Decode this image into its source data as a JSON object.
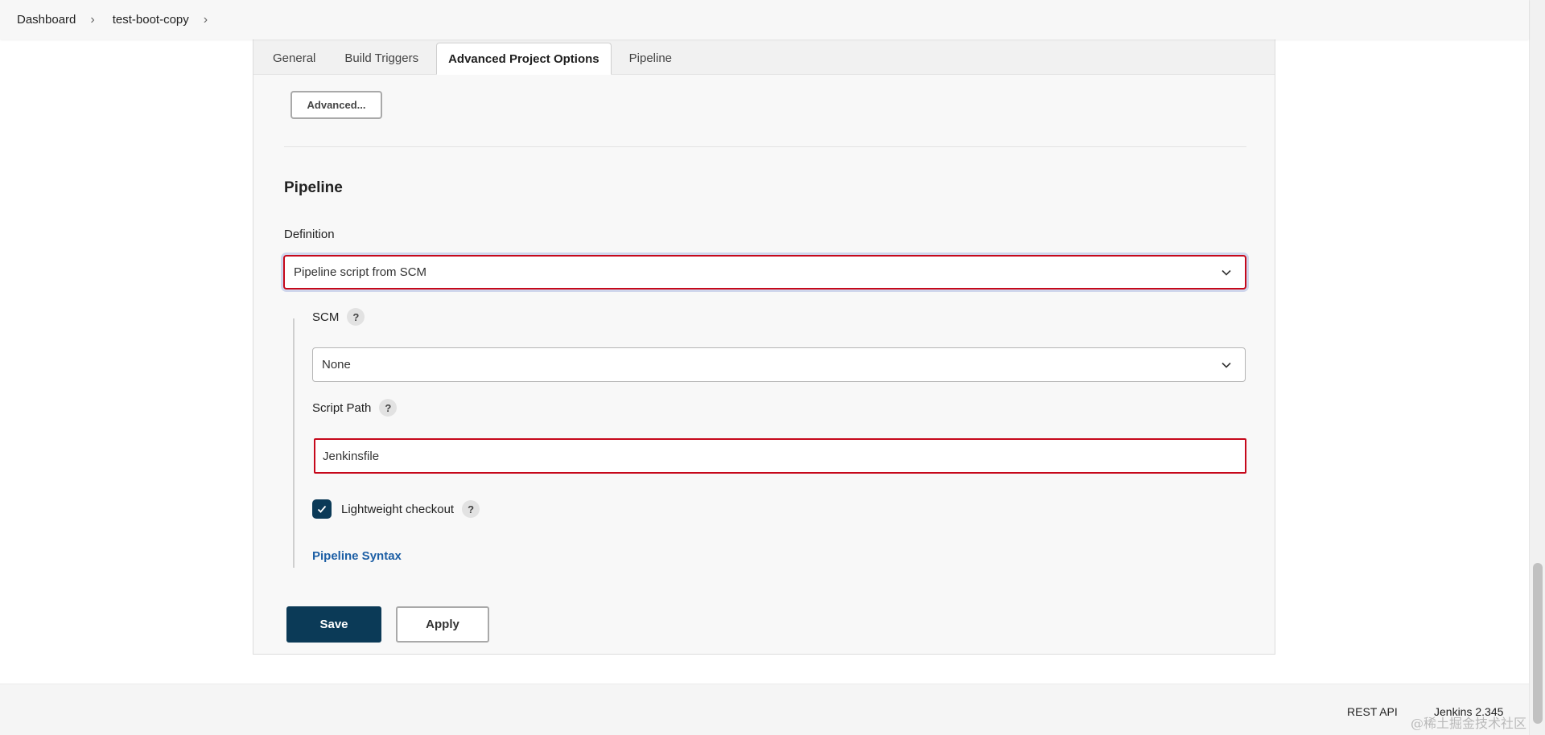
{
  "breadcrumb": {
    "items": [
      "Dashboard",
      "test-boot-copy"
    ],
    "separator": "›"
  },
  "tabs": [
    {
      "label": "General",
      "active": false
    },
    {
      "label": "Build Triggers",
      "active": false
    },
    {
      "label": "Advanced Project Options",
      "active": true
    },
    {
      "label": "Pipeline",
      "active": false
    }
  ],
  "advanced_button": {
    "label": "Advanced..."
  },
  "pipeline": {
    "title": "Pipeline",
    "definition_label": "Definition",
    "definition_value": "Pipeline script from SCM",
    "scm_label": "SCM",
    "scm_value": "None",
    "script_path_label": "Script Path",
    "script_path_value": "Jenkinsfile",
    "lightweight_label": "Lightweight checkout",
    "lightweight_checked": true,
    "syntax_link": "Pipeline Syntax",
    "help_symbol": "?"
  },
  "actions": {
    "save": "Save",
    "apply": "Apply"
  },
  "footer": {
    "rest_api": "REST API",
    "version": "Jenkins 2.345"
  },
  "watermark": "@稀土掘金技术社区",
  "colors": {
    "primary": "#0b3a57",
    "error_border": "#c6081b",
    "link": "#1d5fa5"
  },
  "icons": {
    "chevron": "chevron-down-icon",
    "check": "checkmark-icon",
    "help": "help-icon"
  }
}
